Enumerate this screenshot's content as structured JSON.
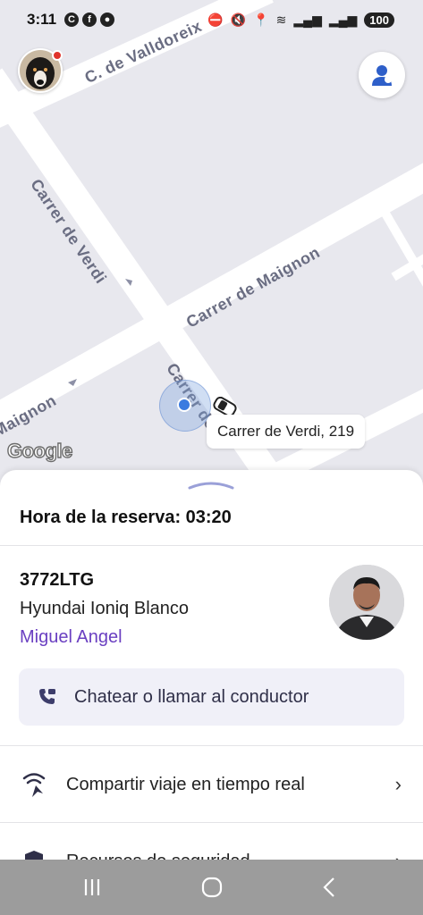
{
  "status_bar": {
    "time": "3:11",
    "battery": "100"
  },
  "map": {
    "streets": {
      "valldoreix": "C. de Valldoreix",
      "verdi_upper": "Carrer de Verdi",
      "maignon": "Carrer de Maignon",
      "maignon_left": "Maignon",
      "verdi_lower": "Carrer de V"
    },
    "address_chip": "Carrer de Verdi, 219",
    "google_logo": "Google",
    "profile_button_icon": "user-icon"
  },
  "sheet": {
    "booking_time": "Hora de la reserva: 03:20",
    "vehicle": {
      "plate": "3772LTG",
      "model": "Hyundai Ioniq Blanco",
      "driver_name": "Miguel Angel"
    },
    "chat_button_label": "Chatear o llamar al conductor",
    "menu": [
      {
        "label": "Compartir viaje en tiempo real",
        "icon": "share-live-icon"
      },
      {
        "label": "Recursos de seguridad",
        "icon": "shield-icon"
      }
    ]
  },
  "colors": {
    "accent": "#6a3fc1",
    "map_bg": "#e8e8ee",
    "chat_bg": "#f0f0f8",
    "nav_bar": "#9c9c9c"
  }
}
